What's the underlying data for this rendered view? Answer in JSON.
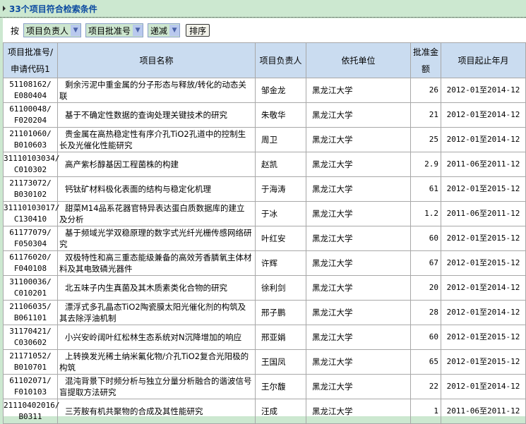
{
  "header": {
    "title": "33个项目符合检索条件"
  },
  "toolbar": {
    "label": "按",
    "sort_field1": "项目负责人",
    "sort_field2": "项目批准号",
    "order": "递减",
    "sort_button": "排序"
  },
  "table": {
    "headers": [
      "项目批准号/申请代码1",
      "项目名称",
      "项目负责人",
      "依托单位",
      "批准金额",
      "项目起止年月"
    ],
    "rows": [
      {
        "code": "51108162/",
        "sub": "E080404",
        "name": "剩余污泥中重金属的分子形态与释放/转化的动态关联",
        "person": "邹金龙",
        "unit": "黑龙江大学",
        "amount": "26",
        "period": "2012-01至2014-12"
      },
      {
        "code": "61100048/",
        "sub": "F020204",
        "name": "基于不确定性数据的查询处理关键技术的研究",
        "person": "朱敬华",
        "unit": "黑龙江大学",
        "amount": "21",
        "period": "2012-01至2014-12"
      },
      {
        "code": "21101060/",
        "sub": "B010603",
        "name": "贵金属在高热稳定性有序介孔TiO2孔道中的控制生长及光催化性能研究",
        "person": "周卫",
        "unit": "黑龙江大学",
        "amount": "25",
        "period": "2012-01至2014-12"
      },
      {
        "code": "31110103034/",
        "sub": "C010302",
        "name": "高产紫杉醇基因工程菌株的构建",
        "person": "赵凯",
        "unit": "黑龙江大学",
        "amount": "2.9",
        "period": "2011-06至2011-12"
      },
      {
        "code": "21173072/",
        "sub": "B030102",
        "name": "钙钛矿材料极化表面的结构与稳定化机理",
        "person": "于海涛",
        "unit": "黑龙江大学",
        "amount": "61",
        "period": "2012-01至2015-12"
      },
      {
        "code": "31110103017/",
        "sub": "C130410",
        "name": "甜菜M14品系花器官特异表达蛋白质数据库的建立及分析",
        "person": "于冰",
        "unit": "黑龙江大学",
        "amount": "1.2",
        "period": "2011-06至2011-12"
      },
      {
        "code": "61177079/",
        "sub": "F050304",
        "name": "基于频域光学双稳原理的数字式光纤光栅传感网络研究",
        "person": "叶红安",
        "unit": "黑龙江大学",
        "amount": "60",
        "period": "2012-01至2015-12"
      },
      {
        "code": "61176020/",
        "sub": "F040108",
        "name": "双极特性和高三重态能级兼备的高效芳香膦氧主体材料及其电致磷光器件",
        "person": "许辉",
        "unit": "黑龙江大学",
        "amount": "67",
        "period": "2012-01至2015-12"
      },
      {
        "code": "31100036/",
        "sub": "C010201",
        "name": "北五味子内生真菌及其木质素类化合物的研究",
        "person": "徐利剑",
        "unit": "黑龙江大学",
        "amount": "20",
        "period": "2012-01至2014-12"
      },
      {
        "code": "21106035/",
        "sub": "B061101",
        "name": "漂浮式多孔晶态TiO2陶瓷膜太阳光催化剂的构筑及其去除浮油机制",
        "person": "邢子鹏",
        "unit": "黑龙江大学",
        "amount": "28",
        "period": "2012-01至2014-12"
      },
      {
        "code": "31170421/",
        "sub": "C030602",
        "name": "小兴安岭阔叶红松林生态系统对N沉降增加的响应",
        "person": "邢亚娟",
        "unit": "黑龙江大学",
        "amount": "60",
        "period": "2012-01至2015-12"
      },
      {
        "code": "21171052/",
        "sub": "B010701",
        "name": "上转换发光稀土纳米氟化物/介孔TiO2复合光阳极的构筑",
        "person": "王国凤",
        "unit": "黑龙江大学",
        "amount": "65",
        "period": "2012-01至2015-12"
      },
      {
        "code": "61102071/",
        "sub": "F010103",
        "name": "混沌背景下时频分析与独立分量分析融合的谐波信号盲提取方法研究",
        "person": "王尔馥",
        "unit": "黑龙江大学",
        "amount": "22",
        "period": "2012-01至2014-12"
      },
      {
        "code": "21110402016/",
        "sub": "B0311",
        "name": "三芳胺有机共聚物的合成及其性能研究",
        "person": "汪成",
        "unit": "黑龙江大学",
        "amount": "1",
        "period": "2011-06至2011-12"
      }
    ]
  }
}
